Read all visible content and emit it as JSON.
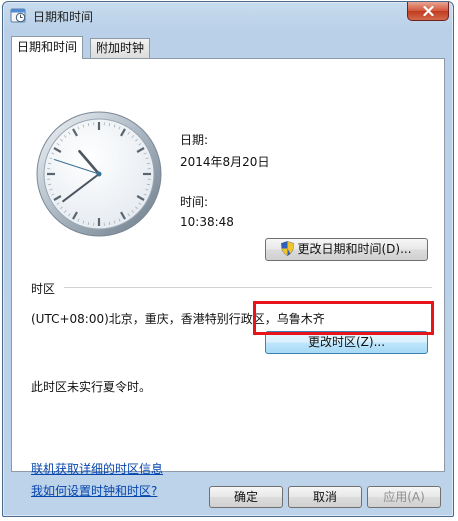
{
  "window": {
    "title": "日期和时间"
  },
  "tabs": [
    {
      "label": "日期和时间",
      "active": true
    },
    {
      "label": "附加时钟",
      "active": false
    }
  ],
  "date_section": {
    "date_label": "日期:",
    "date_value": "2014年8月20日",
    "time_label": "时间:",
    "time_value": "10:38:48",
    "change_datetime_button": "更改日期和时间(D)..."
  },
  "timezone_section": {
    "heading": "时区",
    "current_zone": "(UTC+08:00)北京，重庆，香港特别行政区，乌鲁木齐",
    "change_zone_button": "更改时区(Z)...",
    "dst_notice": "此时区未实行夏令时。"
  },
  "links": {
    "online_info": "联机获取详细的时区信息",
    "how_to_set": "我如何设置时钟和时区?"
  },
  "buttons": {
    "ok": "确定",
    "cancel": "取消",
    "apply": "应用(A)"
  },
  "icons": {
    "title": "clock-calendar-icon",
    "close": "close-icon",
    "uac": "uac-shield-icon"
  },
  "colors": {
    "highlight": "#e8141c",
    "link": "#0645ad"
  },
  "clock": {
    "hour": 10,
    "minute": 38,
    "second": 48
  }
}
